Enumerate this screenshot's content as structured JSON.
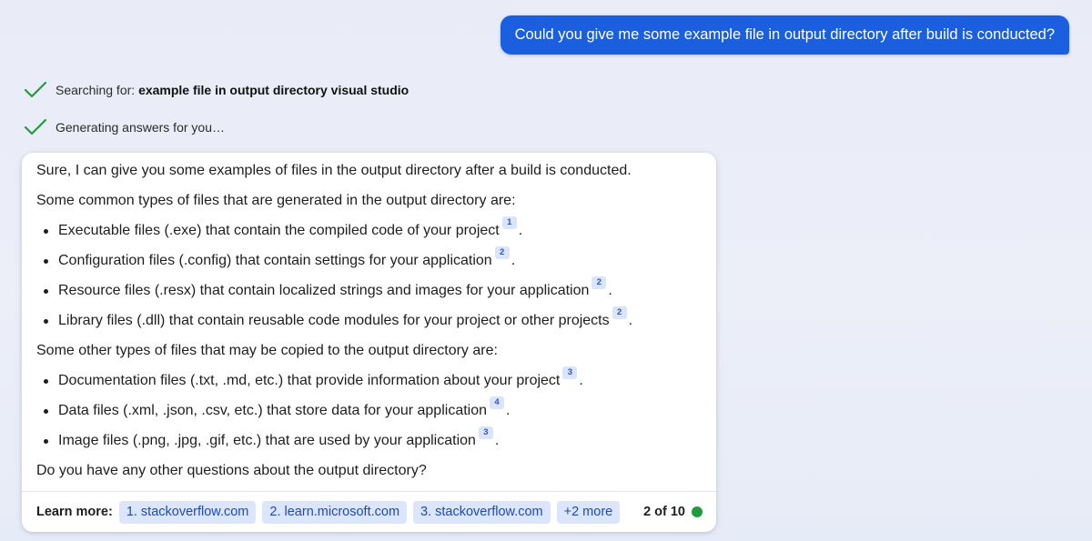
{
  "user_message": "Could you give me some example file in output directory after build is conducted?",
  "status": {
    "searching_prefix": "Searching for:",
    "searching_query": "example file in output directory visual studio",
    "generating": "Generating answers for you…"
  },
  "answer": {
    "intro": "Sure, I can give you some examples of files in the output directory after a build is conducted.",
    "common_heading": "Some common types of files that are generated in the output directory are:",
    "common_items": [
      {
        "text": "Executable files (.exe) that contain the compiled code of your project",
        "cite": "1"
      },
      {
        "text": "Configuration files (.config) that contain settings for your application",
        "cite": "2"
      },
      {
        "text": "Resource files (.resx) that contain localized strings and images for your application",
        "cite": "2"
      },
      {
        "text": "Library files (.dll) that contain reusable code modules for your project or other projects",
        "cite": "2"
      }
    ],
    "other_heading": "Some other types of files that may be copied to the output directory are:",
    "other_items": [
      {
        "text": "Documentation files (.txt, .md, etc.) that provide information about your project",
        "cite": "3"
      },
      {
        "text": "Data files (.xml, .json, .csv, etc.) that store data for your application",
        "cite": "4"
      },
      {
        "text": "Image files (.png, .jpg, .gif, etc.) that are used by your application",
        "cite": "3"
      }
    ],
    "closing": "Do you have any other questions about the output directory?",
    "period": "."
  },
  "footer": {
    "learn_more": "Learn more:",
    "sources": [
      "1. stackoverflow.com",
      "2. learn.microsoft.com",
      "3. stackoverflow.com"
    ],
    "more": "+2 more",
    "page_count": "2 of 10"
  },
  "colors": {
    "user_bubble": "#1a5fe0",
    "check": "#1f9d3c",
    "chip_bg": "#dbe5fb",
    "chip_text": "#2049b8",
    "status_dot": "#1f9d3c"
  },
  "icons": {
    "status_check": "checkmark-icon",
    "response_status": "green-dot-icon"
  }
}
